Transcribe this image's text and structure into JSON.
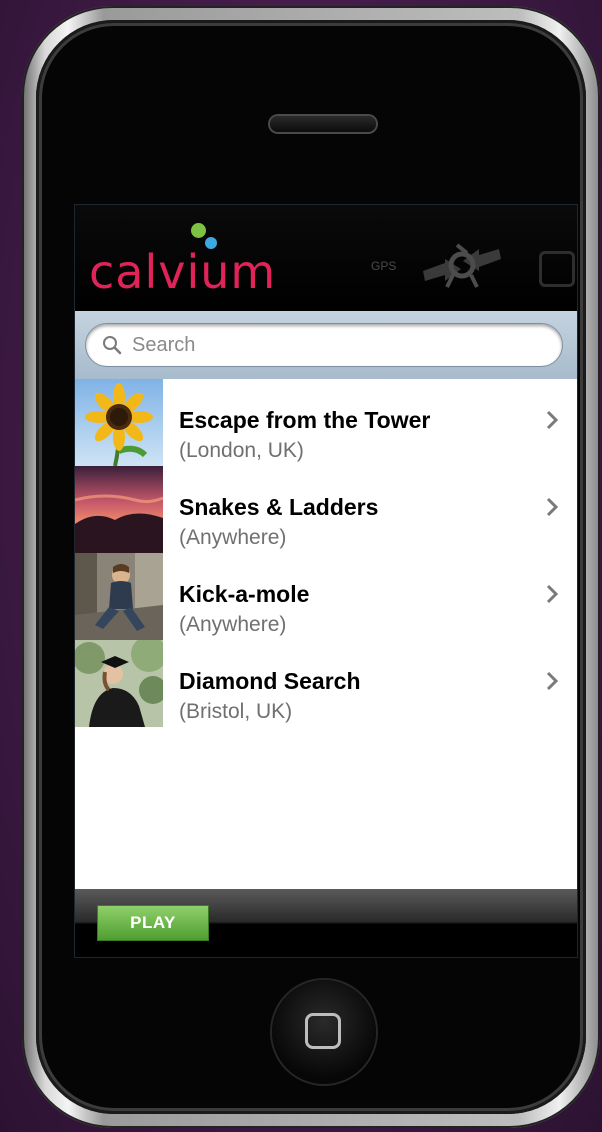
{
  "header": {
    "logo_text": "calvium",
    "gps_label": "GPS"
  },
  "search": {
    "placeholder": "Search"
  },
  "games": [
    {
      "title": "Escape from the Tower",
      "location": "(London, UK)",
      "thumb": "sunflower"
    },
    {
      "title": "Snakes & Ladders",
      "location": "(Anywhere)",
      "thumb": "sunset-sky"
    },
    {
      "title": "Kick-a-mole",
      "location": "(Anywhere)",
      "thumb": "person-sitting"
    },
    {
      "title": "Diamond Search",
      "location": "(Bristol, UK)",
      "thumb": "graduate"
    }
  ],
  "toolbar": {
    "play_label": "PLAY"
  },
  "colors": {
    "brand_pink": "#e0245a",
    "logo_green": "#7dc242",
    "logo_blue": "#3fa8e0",
    "play_green": "#5fb33b"
  }
}
